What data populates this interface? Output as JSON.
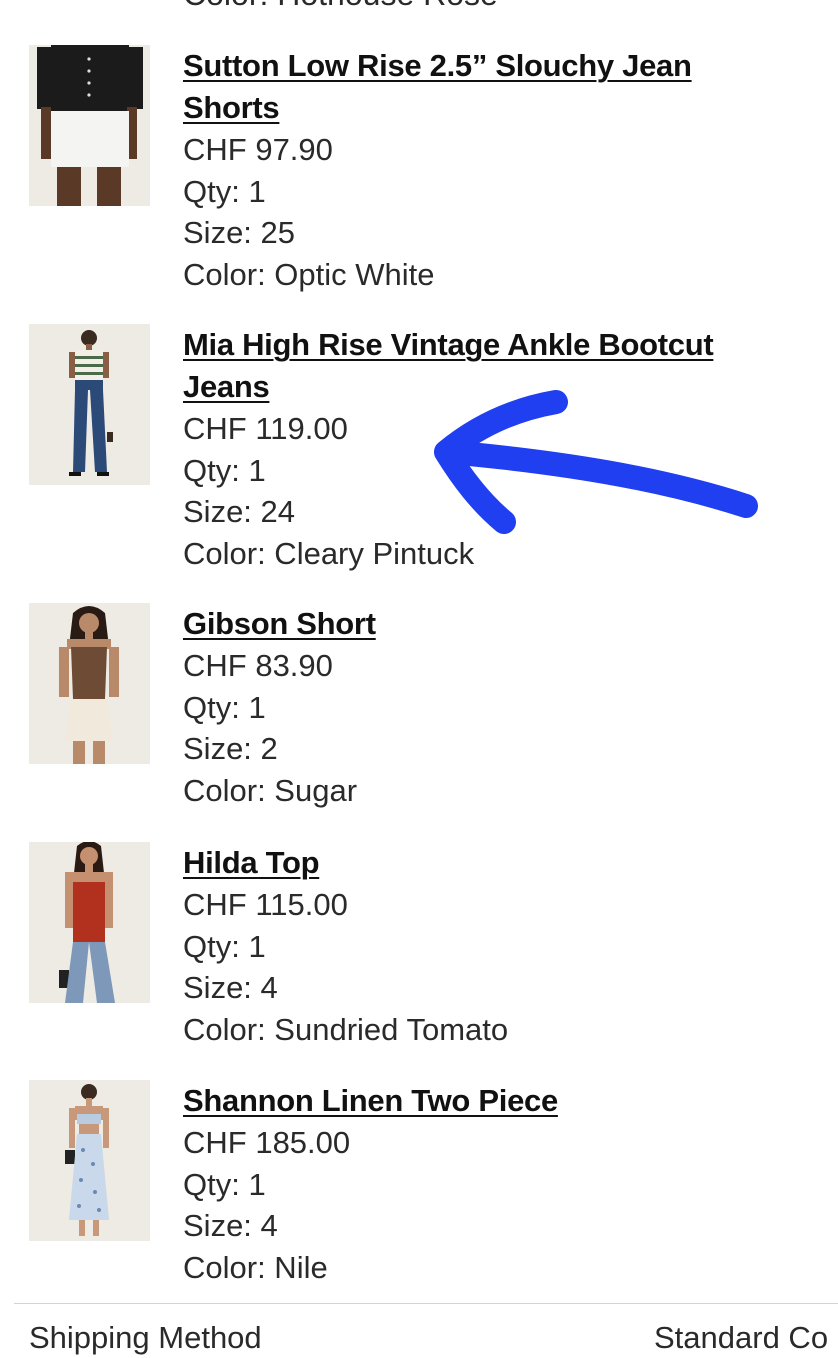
{
  "partial_top_line": "Color: Hothouse Rose",
  "items": [
    {
      "title": "Sutton Low Rise 2.5” Slouchy Jean Shorts",
      "price": "CHF 97.90",
      "qty": "Qty: 1",
      "size": "Size: 25",
      "color": "Color: Optic White",
      "image": "product-photo-black-cardigan-white-shorts"
    },
    {
      "title": "Mia High Rise Vintage Ankle Bootcut Jeans",
      "price": "CHF 119.00",
      "qty": "Qty: 1",
      "size": "Size: 24",
      "color": "Color: Cleary Pintuck",
      "image": "product-photo-striped-top-blue-jeans"
    },
    {
      "title": "Gibson Short",
      "price": "CHF 83.90",
      "qty": "Qty: 1",
      "size": "Size: 2",
      "color": "Color: Sugar",
      "image": "product-photo-brown-vest-cream-shorts"
    },
    {
      "title": "Hilda Top",
      "price": "CHF 115.00",
      "qty": "Qty: 1",
      "size": "Size: 4",
      "color": "Color: Sundried Tomato",
      "image": "product-photo-red-top-jeans"
    },
    {
      "title": "Shannon Linen Two Piece",
      "price": "CHF 185.00",
      "qty": "Qty: 1",
      "size": "Size: 4",
      "color": "Color: Nile",
      "image": "product-photo-floral-two-piece"
    }
  ],
  "shipping": {
    "label": "Shipping Method",
    "value": "Standard Co"
  },
  "annotation": {
    "type": "hand-drawn-arrow",
    "color": "#1f3ff0",
    "points_to": "Mia High Rise Vintage Ankle Bootcut Jeans"
  },
  "colors": {
    "text": "#2a2a2a",
    "title": "#111111",
    "thumb_background": "#eeebe5",
    "divider": "#d4d4d4"
  }
}
